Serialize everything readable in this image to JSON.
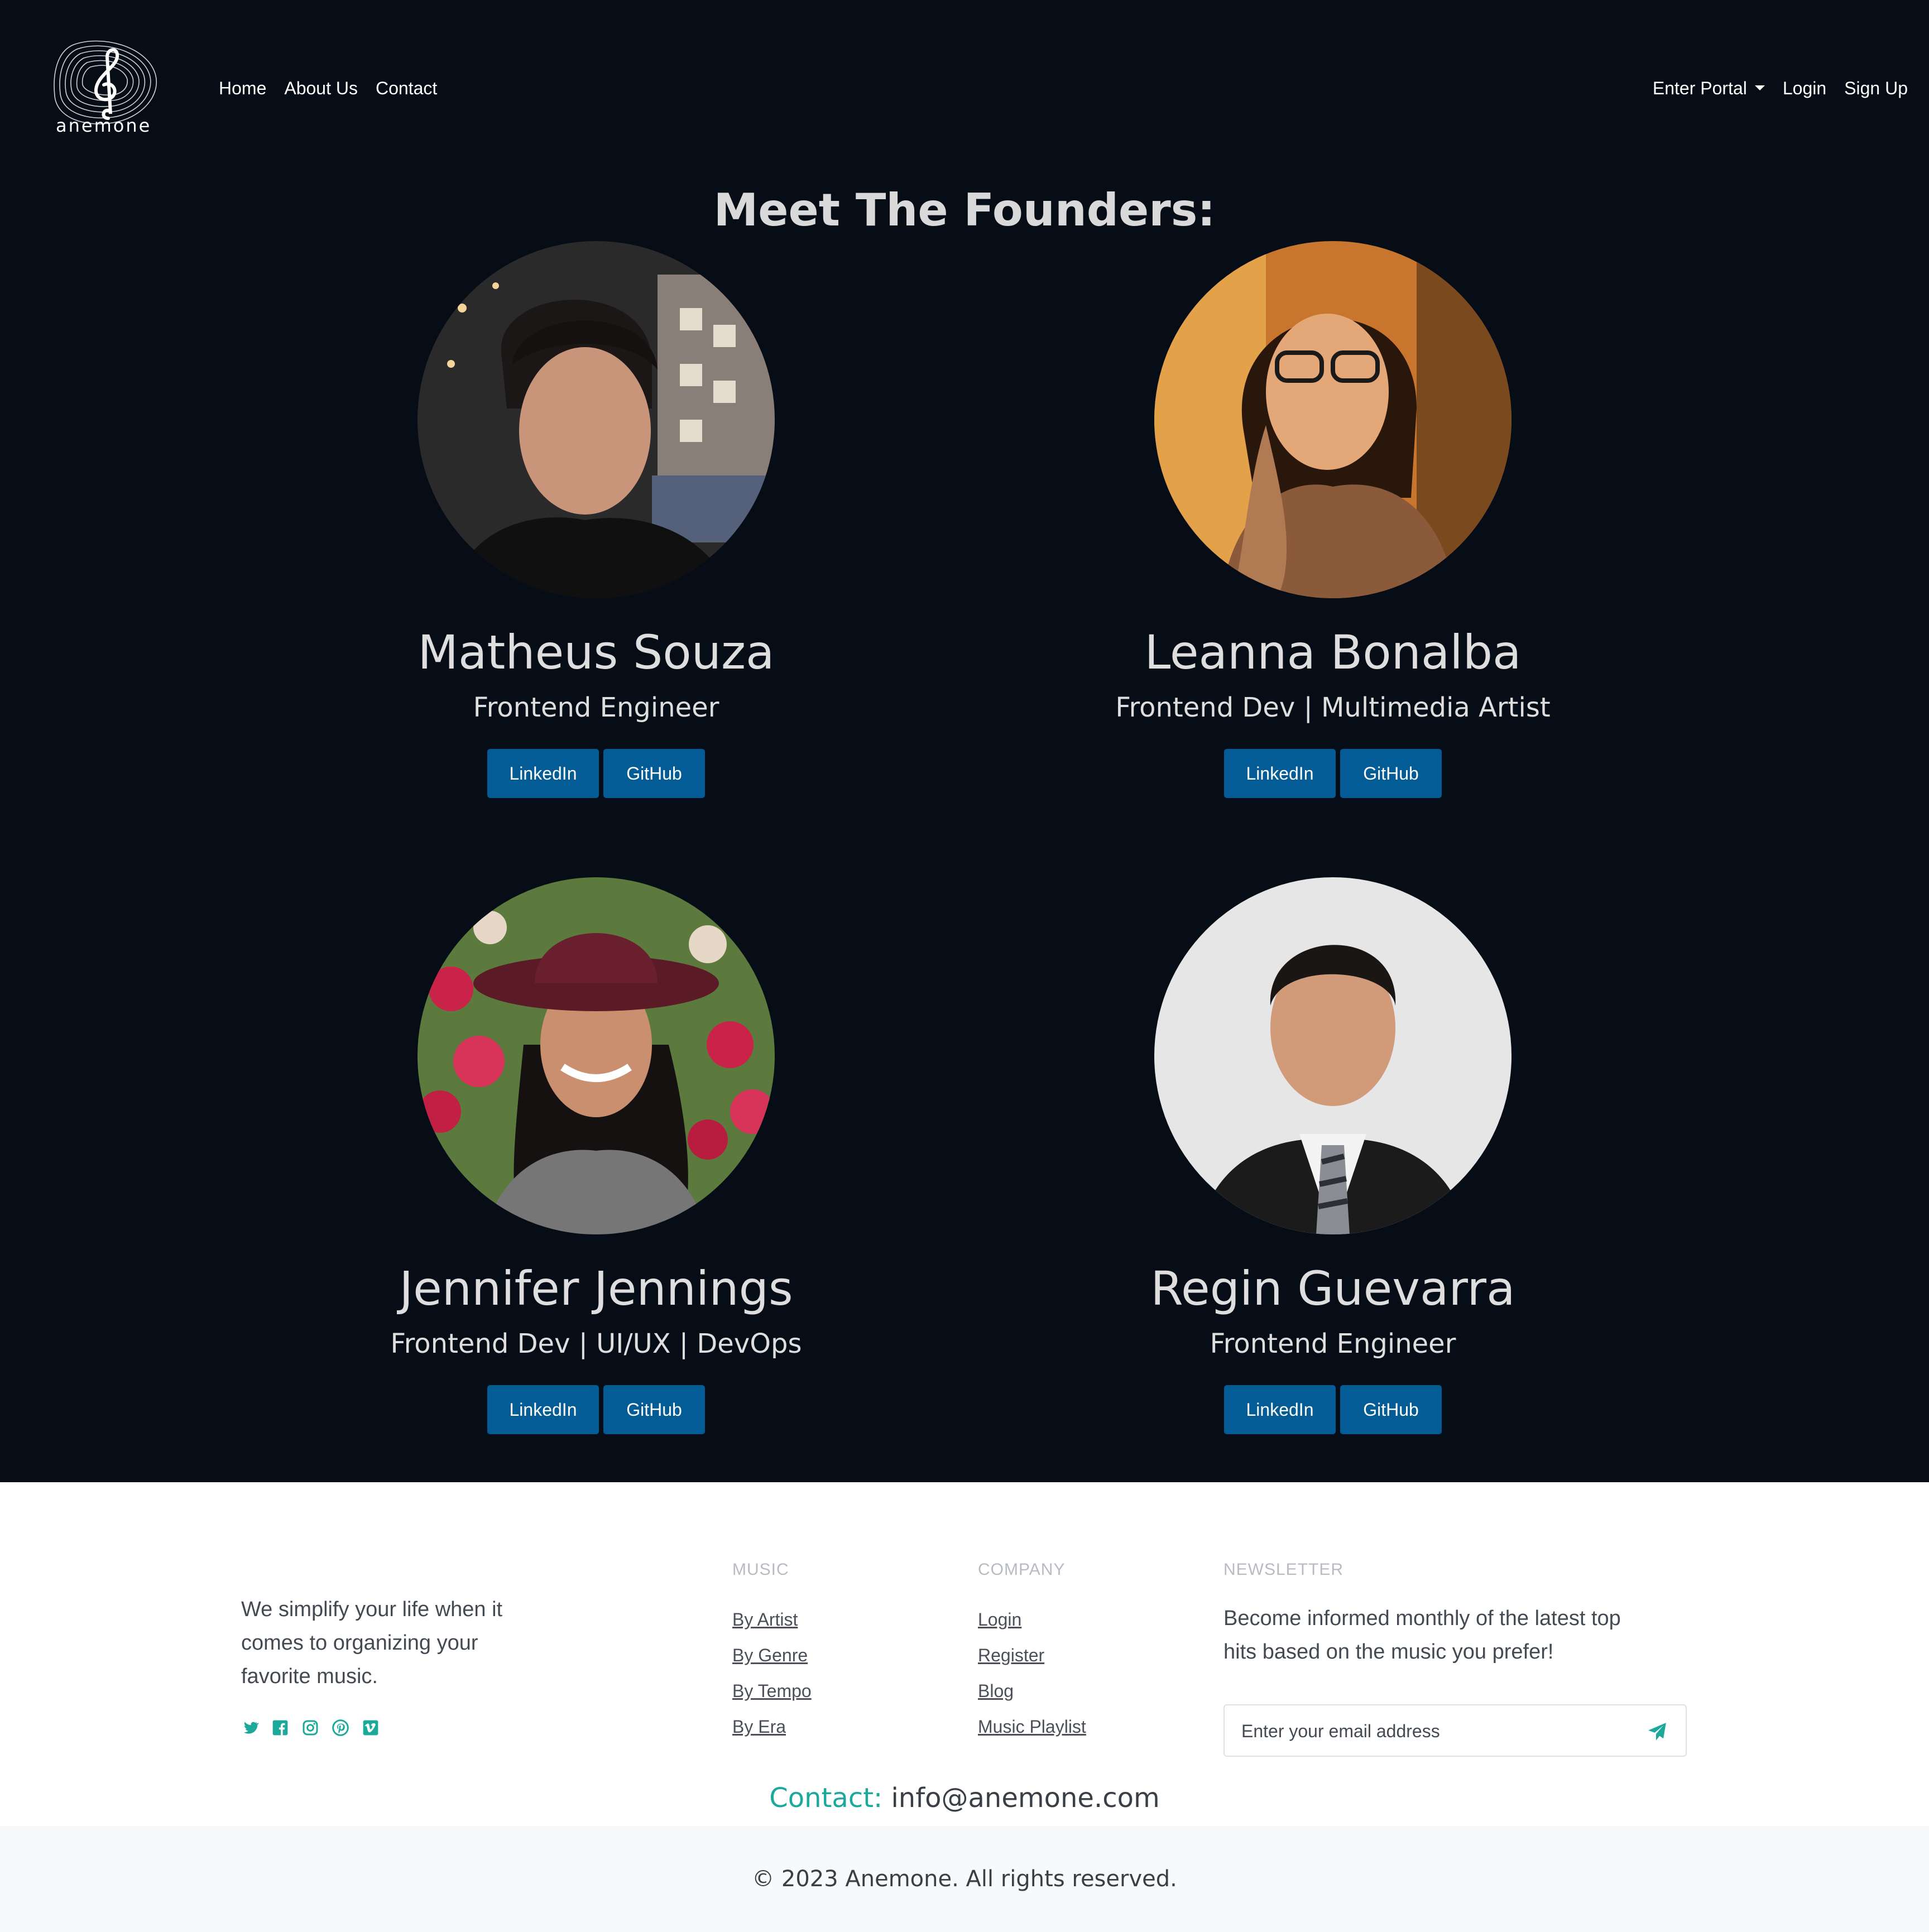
{
  "brand": {
    "name": "anemone",
    "logo_icon": "treble-clef-logo"
  },
  "nav": {
    "left": [
      "Home",
      "About Us",
      "Contact"
    ],
    "portal": "Enter Portal",
    "login": "Login",
    "signup": "Sign Up"
  },
  "section_title": "Meet The Founders:",
  "founders": [
    {
      "name": "Matheus Souza",
      "role": "Frontend Engineer",
      "linkedin": "LinkedIn",
      "github": "GitHub"
    },
    {
      "name": "Leanna Bonalba",
      "role": "Frontend Dev | Multimedia Artist",
      "linkedin": "LinkedIn",
      "github": "GitHub"
    },
    {
      "name": "Jennifer Jennings",
      "role": "Frontend Dev | UI/UX | DevOps",
      "linkedin": "LinkedIn",
      "github": "GitHub"
    },
    {
      "name": "Regin Guevarra",
      "role": "Frontend Engineer",
      "linkedin": "LinkedIn",
      "github": "GitHub"
    }
  ],
  "footer": {
    "about": "We simplify your life when it comes to organizing your favorite music.",
    "socials": [
      "twitter-icon",
      "facebook-icon",
      "instagram-icon",
      "pinterest-icon",
      "vimeo-icon"
    ],
    "music": {
      "heading": "MUSIC",
      "links": [
        "By Artist",
        "By Genre",
        "By Tempo",
        "By Era"
      ]
    },
    "company": {
      "heading": "COMPANY",
      "links": [
        "Login",
        "Register",
        "Blog",
        "Music Playlist"
      ]
    },
    "newsletter": {
      "heading": "NEWSLETTER",
      "text": "Become informed monthly of the latest top hits based on the music you prefer!",
      "placeholder": "Enter your email address"
    },
    "contact_label": "Contact:",
    "contact_email": "info@anemone.com",
    "copyright": "© 2023 Anemone. All rights reserved."
  },
  "colors": {
    "background": "#060d16",
    "button": "#045c96",
    "accent": "#1aa99b"
  }
}
